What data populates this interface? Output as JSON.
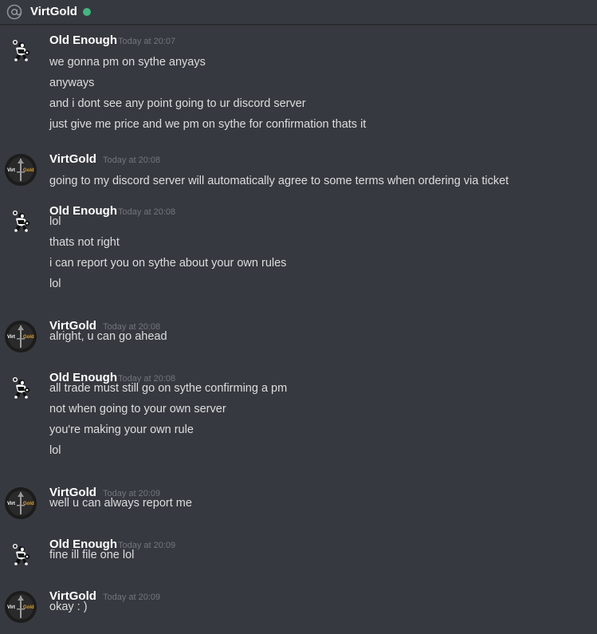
{
  "header": {
    "channel_name": "VirtGold",
    "status": "online",
    "status_color": "#43b581"
  },
  "messages": [
    {
      "author": "Old Enough",
      "timestamp": "Today at 20:07",
      "lines": [
        "we gonna pm on sythe anyays",
        "anyways",
        "and i dont see any point going to ur discord server",
        "just give me price and we pm on sythe for confirmation thats it"
      ]
    },
    {
      "author": "VirtGold",
      "timestamp": "Today at 20:08",
      "lines": [
        "going to my discord server will automatically agree to some terms when ordering via ticket"
      ]
    },
    {
      "author": "Old Enough",
      "timestamp": "Today at 20:08",
      "lines": [
        "lol",
        "thats not right",
        "i can report you on sythe about your own rules",
        "lol"
      ]
    },
    {
      "author": "VirtGold",
      "timestamp": "Today at 20:08",
      "lines": [
        "alright, u can go ahead"
      ]
    },
    {
      "author": "Old Enough",
      "timestamp": "Today at 20:08",
      "lines": [
        "all trade must still go on sythe confirming a pm",
        "not when going to your own server",
        "you're making your own rule",
        "lol"
      ]
    },
    {
      "author": "VirtGold",
      "timestamp": "Today at 20:09",
      "lines": [
        "well u can always report me"
      ]
    },
    {
      "author": "Old Enough",
      "timestamp": "Today at 20:09",
      "lines": [
        "fine ill file one lol"
      ]
    },
    {
      "author": "VirtGold",
      "timestamp": "Today at 20:09",
      "lines": [
        "okay : )"
      ]
    }
  ],
  "avatars": {
    "virtgold_text_left": "Virt",
    "virtgold_text_right": "Gold"
  },
  "colors": {
    "background": "#36393f",
    "username": "#ffffff",
    "message_text": "#dcddde",
    "timestamp": "#72767d",
    "virtgold_accent": "#e0a030"
  }
}
